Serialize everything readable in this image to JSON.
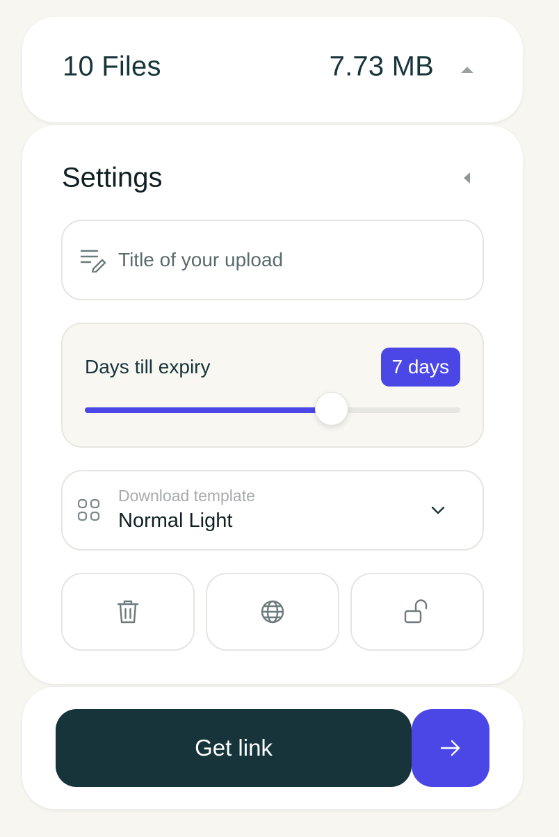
{
  "summary": {
    "file_count": "10 Files",
    "total_size": "7.73 MB",
    "toggle_icon": "caret-up-icon"
  },
  "settings": {
    "heading": "Settings",
    "collapse_icon": "caret-left-icon",
    "title_field": {
      "icon": "edit-text-icon",
      "placeholder": "Title of your upload",
      "value": ""
    },
    "expiry": {
      "label": "Days till expiry",
      "value_badge": "7 days",
      "slider_fraction": 0.658
    },
    "template": {
      "icon": "grid-icon",
      "label": "Download template",
      "value": "Normal Light",
      "dropdown_icon": "chevron-down-icon"
    },
    "actions": [
      {
        "icon": "trash-icon"
      },
      {
        "icon": "globe-icon"
      },
      {
        "icon": "unlock-icon"
      }
    ]
  },
  "footer": {
    "get_link_label": "Get link",
    "go_icon": "arrow-right-icon"
  },
  "colors": {
    "background": "#f7f6f0",
    "accent": "#4a47e6",
    "primary_dark": "#16343a",
    "text": "#17343a"
  }
}
